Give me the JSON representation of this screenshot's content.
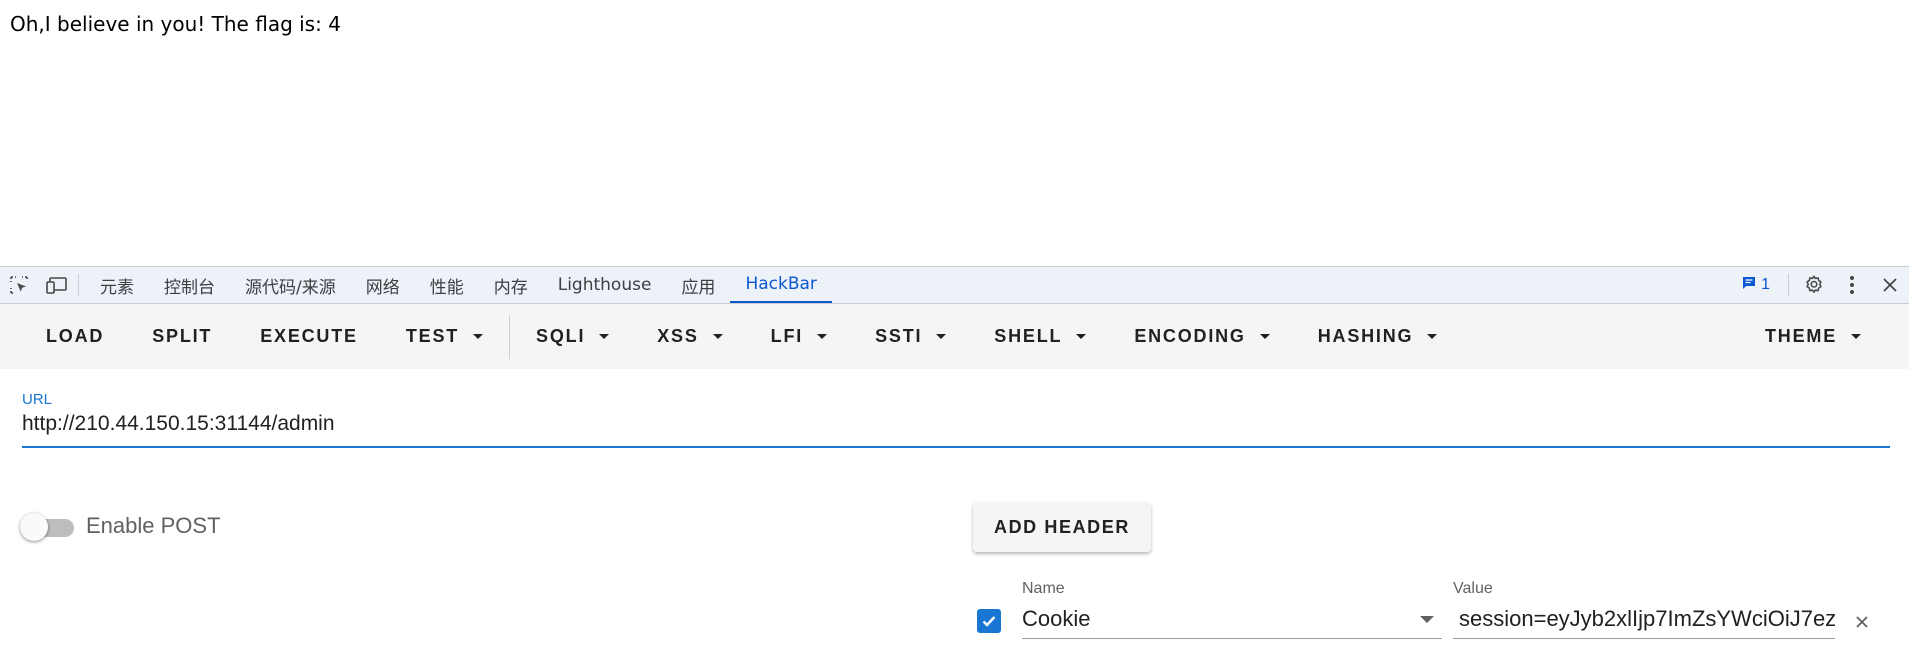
{
  "page": {
    "message": "Oh,I believe in you! The flag is: 4"
  },
  "devtools": {
    "tabs": [
      "元素",
      "控制台",
      "源代码/来源",
      "网络",
      "性能",
      "内存",
      "Lighthouse",
      "应用",
      "HackBar"
    ],
    "active_tab": "HackBar",
    "message_count": "1",
    "icons": {
      "inspect": "select-element-icon",
      "device": "device-toolbar-icon",
      "messages": "message-icon",
      "settings": "gear-icon",
      "more": "more-vert-icon",
      "close": "close-icon"
    },
    "accent_color": "#0b57d0"
  },
  "hackbar": {
    "buttons": {
      "load": "LOAD",
      "split": "SPLIT",
      "execute": "EXECUTE",
      "test": "TEST",
      "sqli": "SQLI",
      "xss": "XSS",
      "lfi": "LFI",
      "ssti": "SSTI",
      "shell": "SHELL",
      "encoding": "ENCODING",
      "hashing": "HASHING",
      "theme": "THEME"
    },
    "url": {
      "label": "URL",
      "value": "http://210.44.150.15:31144/admin"
    },
    "enable_post": {
      "label": "Enable POST",
      "enabled": false
    },
    "add_header_label": "ADD HEADER",
    "headers": [
      {
        "checked": true,
        "name_label": "Name",
        "name": "Cookie",
        "value_label": "Value",
        "value": "session=eyJyb2xlIjp7ImZsYWciOiJ7ez"
      }
    ],
    "primary_color": "#1976d2"
  }
}
